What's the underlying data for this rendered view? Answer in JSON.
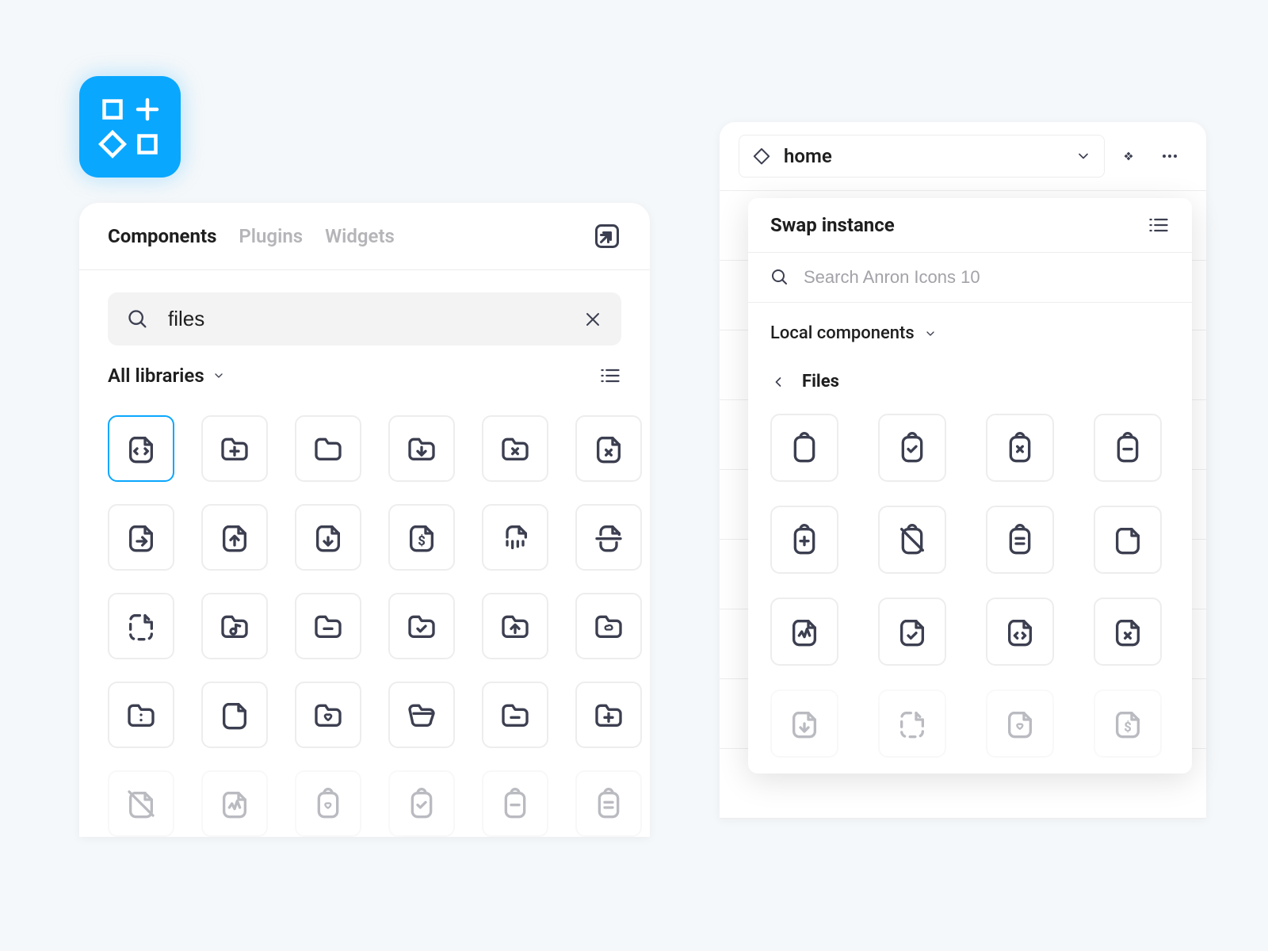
{
  "brand": {
    "name": "figma-assets-icon"
  },
  "components_panel": {
    "tabs": [
      "Components",
      "Plugins",
      "Widgets"
    ],
    "active_tab": "Components",
    "search_value": "files",
    "libraries_label": "All libraries",
    "icons": [
      {
        "name": "file-code",
        "selected": true
      },
      {
        "name": "folder-add"
      },
      {
        "name": "folder"
      },
      {
        "name": "folder-download"
      },
      {
        "name": "folder-remove"
      },
      {
        "name": "file-remove"
      },
      {
        "name": "file-export"
      },
      {
        "name": "file-upload"
      },
      {
        "name": "file-download"
      },
      {
        "name": "file-dollar"
      },
      {
        "name": "file-shred"
      },
      {
        "name": "file-scan"
      },
      {
        "name": "file-dashed"
      },
      {
        "name": "folder-music"
      },
      {
        "name": "folder-minus"
      },
      {
        "name": "folder-check"
      },
      {
        "name": "folder-upload"
      },
      {
        "name": "folder-cloud"
      },
      {
        "name": "folder-more"
      },
      {
        "name": "file-blank"
      },
      {
        "name": "folder-heart"
      },
      {
        "name": "folder-open"
      },
      {
        "name": "folder-minus-2"
      },
      {
        "name": "folder-plus"
      },
      {
        "name": "file-slash",
        "faded": true
      },
      {
        "name": "file-activity",
        "faded": true
      },
      {
        "name": "clipboard-heart",
        "faded": true
      },
      {
        "name": "clipboard-check",
        "faded": true
      },
      {
        "name": "clipboard-minus",
        "faded": true
      },
      {
        "name": "clipboard-text",
        "faded": true
      }
    ]
  },
  "right_panel": {
    "instance_name": "home",
    "swap": {
      "title": "Swap instance",
      "search_placeholder": "Search Anron Icons 10",
      "scope_label": "Local components",
      "category": "Files",
      "icons": [
        {
          "name": "clipboard"
        },
        {
          "name": "clipboard-check"
        },
        {
          "name": "clipboard-remove"
        },
        {
          "name": "clipboard-minus"
        },
        {
          "name": "clipboard-add"
        },
        {
          "name": "clipboard-slash"
        },
        {
          "name": "clipboard-text"
        },
        {
          "name": "file"
        },
        {
          "name": "file-activity"
        },
        {
          "name": "file-check"
        },
        {
          "name": "file-code"
        },
        {
          "name": "file-remove"
        },
        {
          "name": "file-download",
          "faded": true
        },
        {
          "name": "file-dashed",
          "faded": true
        },
        {
          "name": "file-heart",
          "faded": true
        },
        {
          "name": "file-dollar",
          "faded": true
        }
      ]
    }
  }
}
